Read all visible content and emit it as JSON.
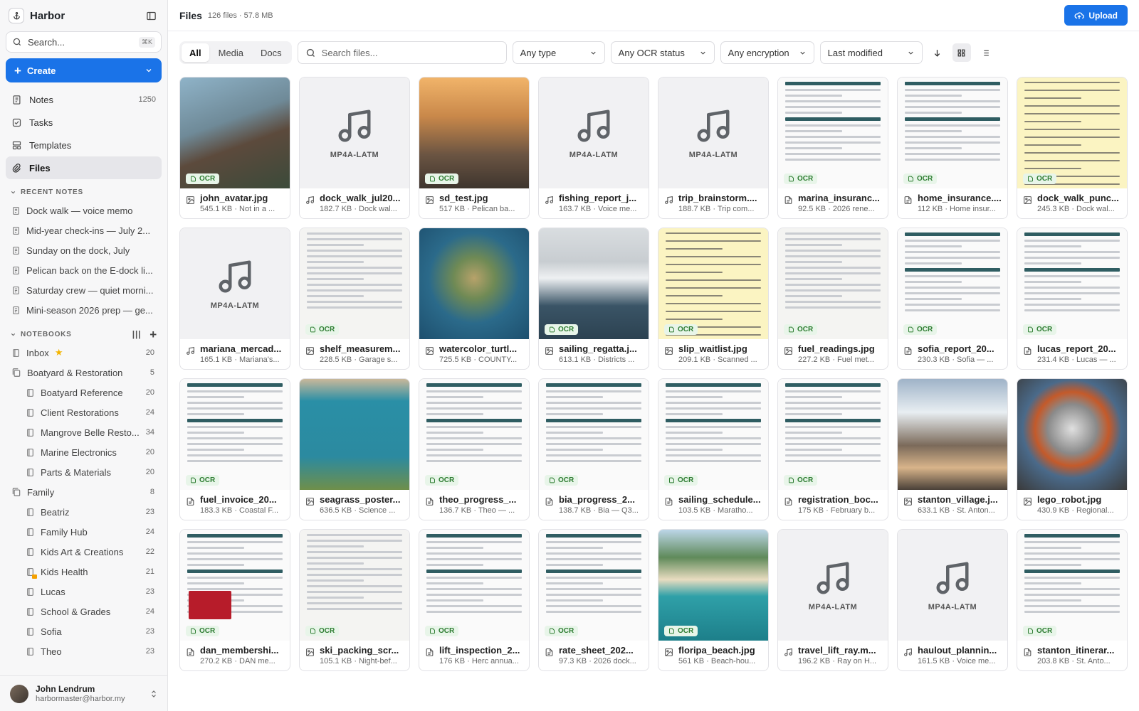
{
  "app": {
    "title": "Harbor"
  },
  "sidebar": {
    "search_label": "Search...",
    "search_shortcut": "⌘K",
    "create_label": "Create",
    "nav": [
      {
        "label": "Notes",
        "count": "1250",
        "icon": "notes-icon"
      },
      {
        "label": "Tasks",
        "count": "",
        "icon": "tasks-icon"
      },
      {
        "label": "Templates",
        "count": "",
        "icon": "templates-icon"
      },
      {
        "label": "Files",
        "count": "",
        "icon": "files-icon",
        "active": true
      }
    ],
    "recent_heading": "RECENT NOTES",
    "recent": [
      "Dock walk — voice memo",
      "Mid-year check-ins — July 2...",
      "Sunday on the dock, July",
      "Pelican back on the E-dock li...",
      "Saturday crew — quiet morni...",
      "Mini-season 2026 prep — ge..."
    ],
    "notebooks_heading": "NOTEBOOKS",
    "notebooks": [
      {
        "label": "Inbox",
        "count": "20",
        "star": true,
        "child": false
      },
      {
        "label": "Boatyard & Restoration",
        "count": "5",
        "child": false,
        "stack": true
      },
      {
        "label": "Boatyard Reference",
        "count": "20",
        "child": true
      },
      {
        "label": "Client Restorations",
        "count": "24",
        "child": true
      },
      {
        "label": "Mangrove Belle Resto...",
        "count": "34",
        "child": true
      },
      {
        "label": "Marine Electronics",
        "count": "20",
        "child": true
      },
      {
        "label": "Parts & Materials",
        "count": "20",
        "child": true
      },
      {
        "label": "Family",
        "count": "8",
        "child": false,
        "stack": true
      },
      {
        "label": "Beatriz",
        "count": "23",
        "child": true
      },
      {
        "label": "Family Hub",
        "count": "24",
        "child": true
      },
      {
        "label": "Kids Art & Creations",
        "count": "22",
        "child": true
      },
      {
        "label": "Kids Health",
        "count": "21",
        "child": true,
        "locked": true
      },
      {
        "label": "Lucas",
        "count": "23",
        "child": true
      },
      {
        "label": "School & Grades",
        "count": "24",
        "child": true
      },
      {
        "label": "Sofia",
        "count": "23",
        "child": true
      },
      {
        "label": "Theo",
        "count": "23",
        "child": true
      }
    ],
    "user": {
      "name": "John Lendrum",
      "email": "harbormaster@harbor.my"
    }
  },
  "header": {
    "title": "Files",
    "meta": "126 files · 57.8 MB",
    "upload_label": "Upload"
  },
  "toolbar": {
    "tabs": [
      "All",
      "Media",
      "Docs"
    ],
    "search_placeholder": "Search files...",
    "filters": {
      "type": "Any type",
      "ocr": "Any OCR status",
      "encryption": "Any encryption",
      "sort": "Last modified"
    }
  },
  "ocr_label": "OCR",
  "audio_label": "MP4A-LATM",
  "colors": {
    "accent": "#1a73e8",
    "ocr_green": "#2e7d32"
  },
  "files": [
    {
      "name": "john_avatar.jpg",
      "meta": "545.1 KB · Not in a ...",
      "kind": "photo",
      "ocr": true,
      "bg": "linear-gradient(160deg,#8fb3c8 0%,#6f8a98 40%,#5c4a3c 60%,#3b4a3a 100%)"
    },
    {
      "name": "dock_walk_jul20...",
      "meta": "182.7 KB · Dock wal...",
      "kind": "audio",
      "ocr": false
    },
    {
      "name": "sd_test.jpg",
      "meta": "517 KB · Pelican ba...",
      "kind": "photo",
      "ocr": true,
      "bg": "linear-gradient(180deg,#f1b46a 0%,#c9884a 35%,#6a5442 70%,#3e352e 100%)"
    },
    {
      "name": "fishing_report_j...",
      "meta": "163.7 KB · Voice me...",
      "kind": "audio",
      "ocr": false
    },
    {
      "name": "trip_brainstorm....",
      "meta": "188.7 KB · Trip com...",
      "kind": "audio",
      "ocr": false
    },
    {
      "name": "marina_insuranc...",
      "meta": "92.5 KB · 2026 rene...",
      "kind": "doc",
      "ocr": true
    },
    {
      "name": "home_insurance....",
      "meta": "112 KB · Home insur...",
      "kind": "doc",
      "ocr": true
    },
    {
      "name": "dock_walk_punc...",
      "meta": "245.3 KB · Dock wal...",
      "kind": "yellow",
      "ocr": true
    },
    {
      "name": "mariana_mercad...",
      "meta": "165.1 KB · Mariana's...",
      "kind": "audio",
      "ocr": false
    },
    {
      "name": "shelf_measurem...",
      "meta": "228.5 KB · Garage s...",
      "kind": "paper",
      "ocr": true
    },
    {
      "name": "watercolor_turtl...",
      "meta": "725.5 KB · COUNTY...",
      "kind": "photo",
      "ocr": false,
      "bg": "radial-gradient(circle at 50% 45%,#b7a26a 0%,#6f8a55 25%,#2b6a8a 55%,#1d4f6e 100%)"
    },
    {
      "name": "sailing_regatta.j...",
      "meta": "613.1 KB · Districts ...",
      "kind": "photo",
      "ocr": true,
      "bg": "linear-gradient(180deg,#d9dde0 0%,#c8cdd1 30%,#eef0f2 45%,#3a5466 70%,#2c4251 100%)"
    },
    {
      "name": "slip_waitlist.jpg",
      "meta": "209.1 KB · Scanned ...",
      "kind": "yellow",
      "ocr": true
    },
    {
      "name": "fuel_readings.jpg",
      "meta": "227.2 KB · Fuel met...",
      "kind": "paper",
      "ocr": true
    },
    {
      "name": "sofia_report_20...",
      "meta": "230.3 KB · Sofia — ...",
      "kind": "doc",
      "ocr": true
    },
    {
      "name": "lucas_report_20...",
      "meta": "231.4 KB · Lucas — ...",
      "kind": "doc",
      "ocr": true
    },
    {
      "name": "fuel_invoice_20...",
      "meta": "183.3 KB · Coastal F...",
      "kind": "doc",
      "ocr": true
    },
    {
      "name": "seagrass_poster...",
      "meta": "636.5 KB · Science ...",
      "kind": "photo",
      "ocr": false,
      "bg": "linear-gradient(180deg,#c9b89a 0%,#2a8fa6 20%,#2b8aa0 70%,#6f8f4a 100%)"
    },
    {
      "name": "theo_progress_...",
      "meta": "136.7 KB · Theo — ...",
      "kind": "doc",
      "ocr": true
    },
    {
      "name": "bia_progress_2...",
      "meta": "138.7 KB · Bia — Q3...",
      "kind": "doc",
      "ocr": true
    },
    {
      "name": "sailing_schedule...",
      "meta": "103.5 KB · Maratho...",
      "kind": "doc",
      "ocr": true
    },
    {
      "name": "registration_boc...",
      "meta": "175 KB · February b...",
      "kind": "doc",
      "ocr": true
    },
    {
      "name": "stanton_village.j...",
      "meta": "633.1 KB · St. Anton...",
      "kind": "photo",
      "ocr": false,
      "bg": "linear-gradient(180deg,#9fb3c8 0%,#e8eef2 30%,#7b6a5a 60%,#d8b48a 80%,#4a4038 100%)"
    },
    {
      "name": "lego_robot.jpg",
      "meta": "430.9 KB · Regional...",
      "kind": "photo",
      "ocr": false,
      "bg": "radial-gradient(circle at 50% 45%,#e0e0e0 0%,#8a8a8a 30%,#c45a2a 45%,#4a6a8a 60%,#3a3a3a 100%)"
    },
    {
      "name": "dan_membershi...",
      "meta": "270.2 KB · DAN me...",
      "kind": "doc-red",
      "ocr": true
    },
    {
      "name": "ski_packing_scr...",
      "meta": "105.1 KB · Night-bef...",
      "kind": "paper",
      "ocr": true
    },
    {
      "name": "lift_inspection_2...",
      "meta": "176 KB · Herc annua...",
      "kind": "doc",
      "ocr": true
    },
    {
      "name": "rate_sheet_202...",
      "meta": "97.3 KB · 2026 dock...",
      "kind": "doc",
      "ocr": true
    },
    {
      "name": "floripa_beach.jpg",
      "meta": "561 KB · Beach-hou...",
      "kind": "photo",
      "ocr": true,
      "bg": "linear-gradient(180deg,#bcd6e8 0%,#5f8a5a 25%,#e8dcc0 45%,#2fa0a8 60%,#1d7f8a 100%)"
    },
    {
      "name": "travel_lift_ray.m...",
      "meta": "196.2 KB · Ray on H...",
      "kind": "audio",
      "ocr": false
    },
    {
      "name": "haulout_plannin...",
      "meta": "161.5 KB · Voice me...",
      "kind": "audio",
      "ocr": false
    },
    {
      "name": "stanton_itinerar...",
      "meta": "203.8 KB · St. Anto...",
      "kind": "doc",
      "ocr": true
    }
  ]
}
